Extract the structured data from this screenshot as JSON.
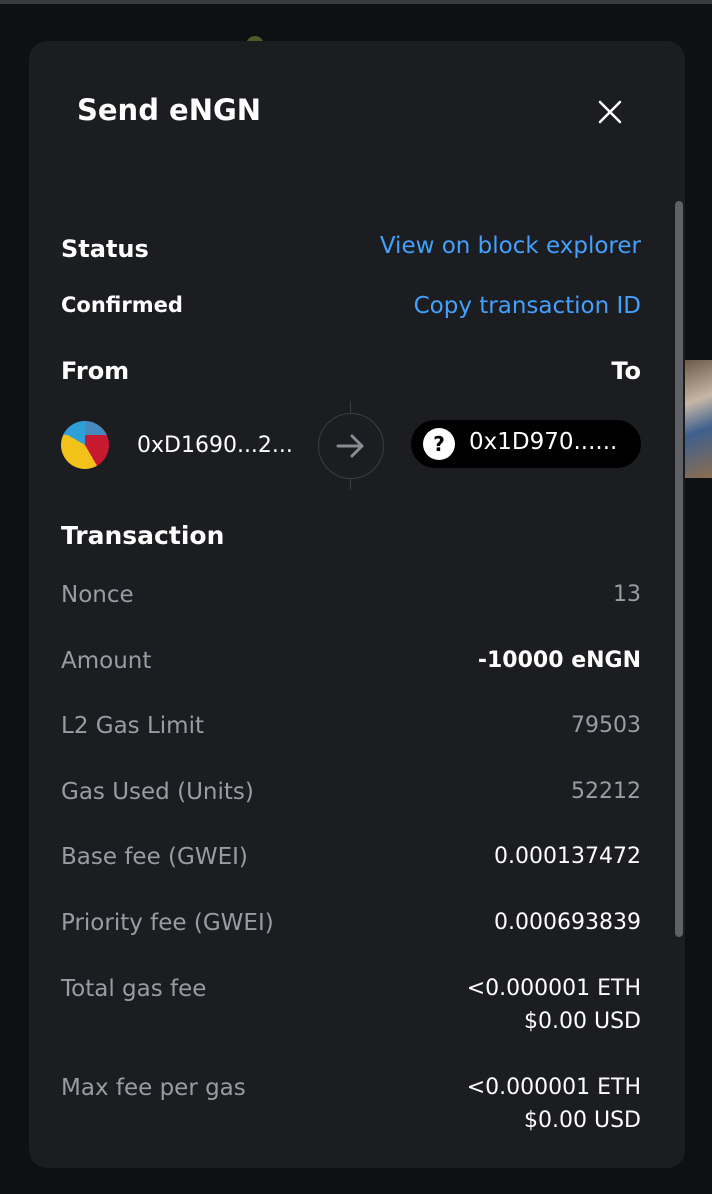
{
  "modal": {
    "title": "Send eNGN"
  },
  "status": {
    "label": "Status",
    "value": "Confirmed",
    "view_explorer": "View on block explorer",
    "copy_tx": "Copy transaction ID"
  },
  "parties": {
    "from_label": "From",
    "to_label": "To",
    "from_address": "0xD1690...2...",
    "to_address": "0x1D970......"
  },
  "transaction": {
    "heading": "Transaction",
    "rows": [
      {
        "label": "Nonce",
        "value": "13"
      },
      {
        "label": "Amount",
        "value": "-10000 eNGN"
      },
      {
        "label": "L2 Gas Limit",
        "value": "79503"
      },
      {
        "label": "Gas Used (Units)",
        "value": "52212"
      },
      {
        "label": "Base fee (GWEI)",
        "value": "0.000137472"
      },
      {
        "label": "Priority fee (GWEI)",
        "value": "0.000693839"
      },
      {
        "label": "Total gas fee",
        "value": "<0.000001 ETH",
        "value2": "$0.00 USD"
      },
      {
        "label": "Max fee per gas",
        "value": "<0.000001 ETH",
        "value2": "$0.00 USD"
      }
    ]
  },
  "colors": {
    "background": "#1c1d20",
    "link": "#43a0ff",
    "muted_text": "#9a9ca3"
  }
}
